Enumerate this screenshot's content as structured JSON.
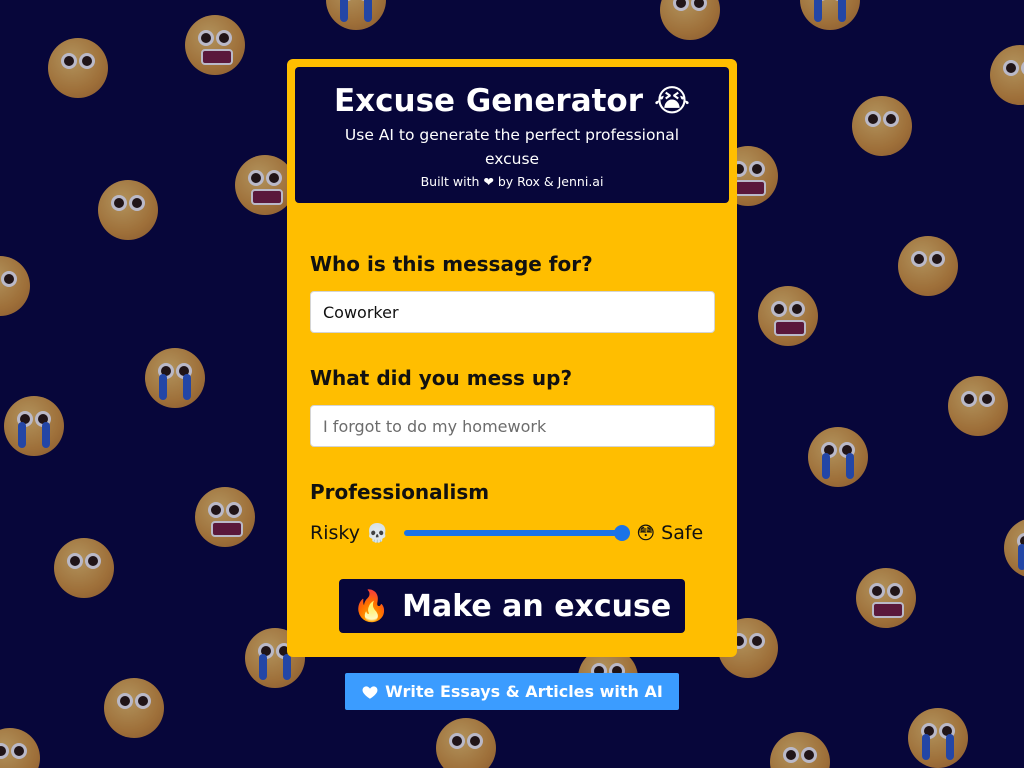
{
  "header": {
    "title": "Excuse Generator",
    "title_emoji": "😭",
    "subtitle": "Use AI to generate the perfect professional excuse",
    "built_with": "Built with ❤ by Rox & Jenni.ai"
  },
  "form": {
    "recipient": {
      "label": "Who is this message for?",
      "value": "Coworker"
    },
    "mistake": {
      "label": "What did you mess up?",
      "placeholder": "I forgot to do my homework",
      "value": ""
    },
    "professionalism": {
      "label": "Professionalism",
      "left_label": "Risky",
      "left_emoji": "💀",
      "right_label": "Safe",
      "right_emoji": "😳",
      "value_fraction": 1.0
    },
    "submit": {
      "emoji": "🔥",
      "label": "Make an excuse"
    }
  },
  "promo_button": {
    "label": "Write Essays & Articles with AI",
    "icon": "heart-icon"
  },
  "colors": {
    "background": "#07063a",
    "card": "#ffbe00",
    "accent": "#1a73e8",
    "promo": "#3b9cff"
  }
}
